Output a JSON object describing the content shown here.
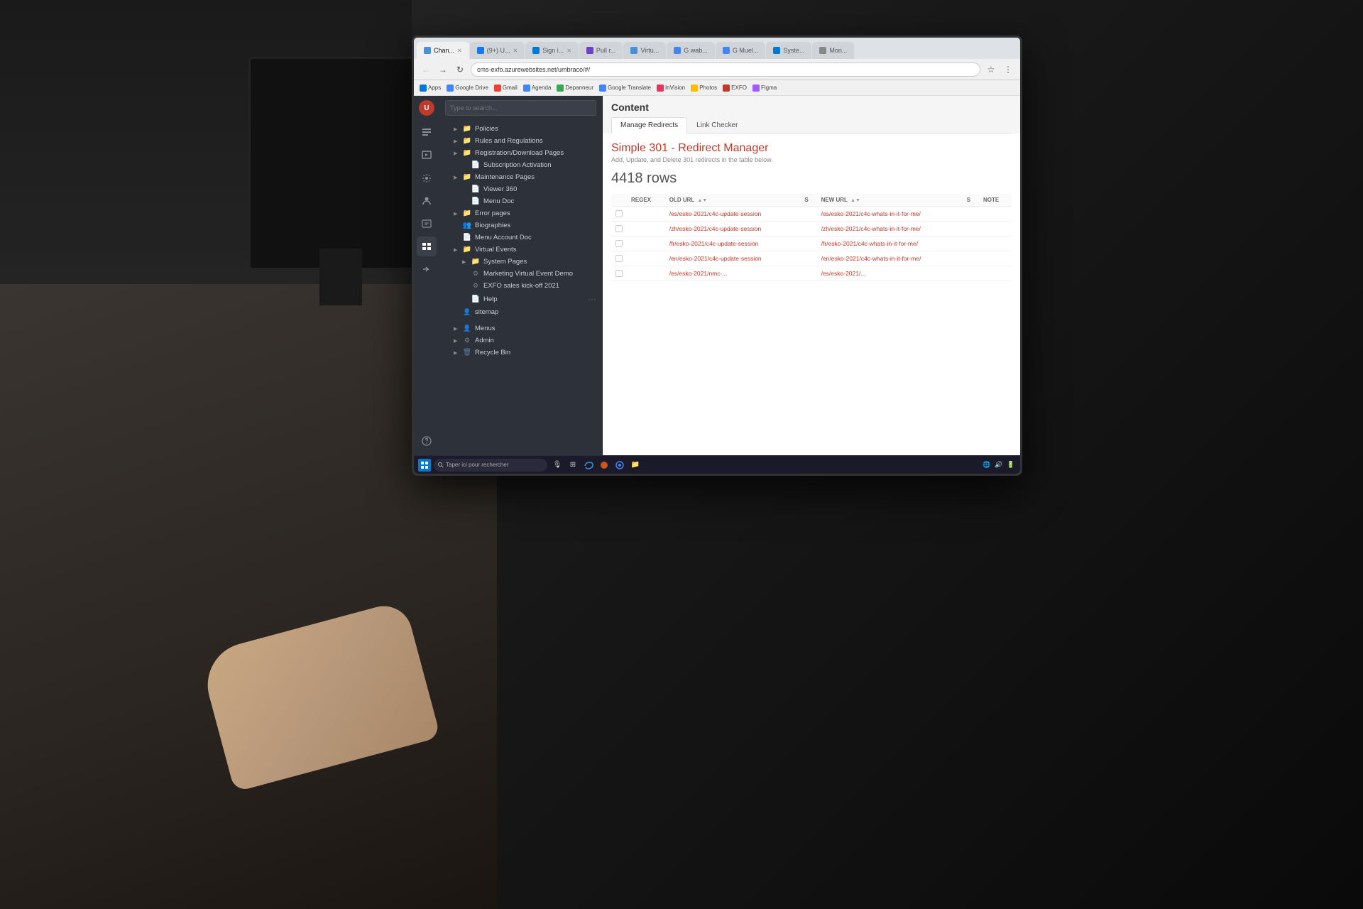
{
  "browser": {
    "tabs": [
      {
        "label": "Chan...",
        "active": true,
        "favicon_color": "#4a90d9"
      },
      {
        "label": "(9+) U...",
        "active": false,
        "favicon_color": "#1877f2"
      },
      {
        "label": "Sign i...",
        "active": false,
        "favicon_color": "#0078d4"
      },
      {
        "label": "Pull r...",
        "active": false,
        "favicon_color": "#6e40c9"
      },
      {
        "label": "Virtu...",
        "active": false,
        "favicon_color": "#4a90d9"
      },
      {
        "label": "G wab...",
        "active": false,
        "favicon_color": "#4285f4"
      },
      {
        "label": "G Muel...",
        "active": false,
        "favicon_color": "#4285f4"
      },
      {
        "label": "Syste...",
        "active": false,
        "favicon_color": "#0078d4"
      },
      {
        "label": "Mon...",
        "active": false,
        "favicon_color": "#888"
      }
    ],
    "address": "cms-exfo.azurewebsites.net/umbraco/#/",
    "bookmarks": [
      {
        "label": "Apps",
        "icon": "#0078d4"
      },
      {
        "label": "Google Drive",
        "icon": "#4285f4"
      },
      {
        "label": "Gmail",
        "icon": "#ea4335"
      },
      {
        "label": "Agenda",
        "icon": "#4285f4"
      },
      {
        "label": "Depanneur",
        "icon": "#34a853"
      },
      {
        "label": "Google Translate",
        "icon": "#4285f4"
      },
      {
        "label": "InVision",
        "icon": "#e3365e"
      },
      {
        "label": "Photos",
        "icon": "#fbbc04"
      },
      {
        "label": "EXFO",
        "icon": "#c0392b"
      },
      {
        "label": "Figma",
        "icon": "#a259ff"
      }
    ]
  },
  "sidebar": {
    "icons": [
      {
        "name": "document-icon",
        "symbol": "📄"
      },
      {
        "name": "image-icon",
        "symbol": "🖼"
      },
      {
        "name": "wrench-icon",
        "symbol": "🔧"
      },
      {
        "name": "settings-icon",
        "symbol": "⚙"
      },
      {
        "name": "user-icon",
        "symbol": "👤"
      },
      {
        "name": "grid-icon",
        "symbol": "▦"
      },
      {
        "name": "layout-icon",
        "symbol": "▤"
      },
      {
        "name": "arrow-icon",
        "symbol": "→"
      },
      {
        "name": "question-icon",
        "symbol": "?"
      }
    ]
  },
  "search": {
    "placeholder": "Type to search..."
  },
  "tree": {
    "items": [
      {
        "label": "Policies",
        "level": 1,
        "has_arrow": true,
        "icon": "folder"
      },
      {
        "label": "Rules and Regulations",
        "level": 1,
        "has_arrow": true,
        "icon": "folder"
      },
      {
        "label": "Registration/Download Pages",
        "level": 1,
        "has_arrow": true,
        "icon": "folder"
      },
      {
        "label": "Subscription Activation",
        "level": 1,
        "has_arrow": false,
        "icon": "file"
      },
      {
        "label": "Maintenance Pages",
        "level": 1,
        "has_arrow": true,
        "icon": "folder"
      },
      {
        "label": "Viewer 360",
        "level": 2,
        "has_arrow": false,
        "icon": "file"
      },
      {
        "label": "Menu Doc",
        "level": 2,
        "has_arrow": false,
        "icon": "file"
      },
      {
        "label": "Error pages",
        "level": 1,
        "has_arrow": true,
        "icon": "folder"
      },
      {
        "label": "Biographies",
        "level": 1,
        "has_arrow": false,
        "icon": "people"
      },
      {
        "label": "Menu Account Doc",
        "level": 1,
        "has_arrow": false,
        "icon": "file"
      },
      {
        "label": "Virtual Events",
        "level": 1,
        "has_arrow": true,
        "icon": "folder"
      },
      {
        "label": "System Pages",
        "level": 2,
        "has_arrow": true,
        "icon": "folder"
      },
      {
        "label": "Marketing Virtual Event Demo",
        "level": 2,
        "has_arrow": false,
        "icon": "event"
      },
      {
        "label": "EXFO sales kick-off 2021",
        "level": 2,
        "has_arrow": false,
        "icon": "event"
      },
      {
        "label": "Help",
        "level": 2,
        "has_arrow": false,
        "icon": "file"
      },
      {
        "label": "sitemap",
        "level": 1,
        "has_arrow": false,
        "icon": "sitemap"
      },
      {
        "label": "Menus",
        "level": 0,
        "has_arrow": true,
        "icon": "menu"
      },
      {
        "label": "Admin",
        "level": 0,
        "has_arrow": true,
        "icon": "settings"
      },
      {
        "label": "Recycle Bin",
        "level": 0,
        "has_arrow": true,
        "icon": "folder"
      }
    ]
  },
  "content": {
    "title": "Content",
    "tabs": [
      {
        "label": "Manage Redirects",
        "active": true
      },
      {
        "label": "Link Checker",
        "active": false
      }
    ],
    "redirect_manager": {
      "title": "Simple 301 - Redirect Manager",
      "subtitle": "Add, Update, and Delete 301 redirects in the table below.",
      "rows_count": "4418 rows",
      "table": {
        "columns": [
          {
            "label": "REGEX",
            "sortable": false
          },
          {
            "label": "OLD URL",
            "sortable": true
          },
          {
            "label": "S",
            "sortable": false
          },
          {
            "label": "NEW URL",
            "sortable": true
          },
          {
            "label": "S",
            "sortable": false
          },
          {
            "label": "NOTE",
            "sortable": false
          }
        ],
        "rows": [
          {
            "old_url": "/es/esko-2021/c4c-update-session",
            "new_url": "/es/esko-2021/c4c-whats-in-it-for-me/",
            "note": ""
          },
          {
            "old_url": "/zh/esko-2021/c4c-update-session",
            "new_url": "/zh/esko-2021/c4c-whats-in-it-for-me/",
            "note": ""
          },
          {
            "old_url": "/fr/esko-2021/c4c-update-session",
            "new_url": "/fr/esko-2021/c4c-whats-in-it-for-me/",
            "note": ""
          },
          {
            "old_url": "/en/esko-2021/c4c-update-session",
            "new_url": "/en/esko-2021/c4c-whats-in-it-for-me/",
            "note": ""
          },
          {
            "old_url": "/es/esko-2021/nmc-...",
            "new_url": "/es/esko-2021/...",
            "note": ""
          }
        ]
      }
    }
  },
  "taskbar": {
    "search_placeholder": "Taper ici pour rechercher",
    "time": "..."
  }
}
